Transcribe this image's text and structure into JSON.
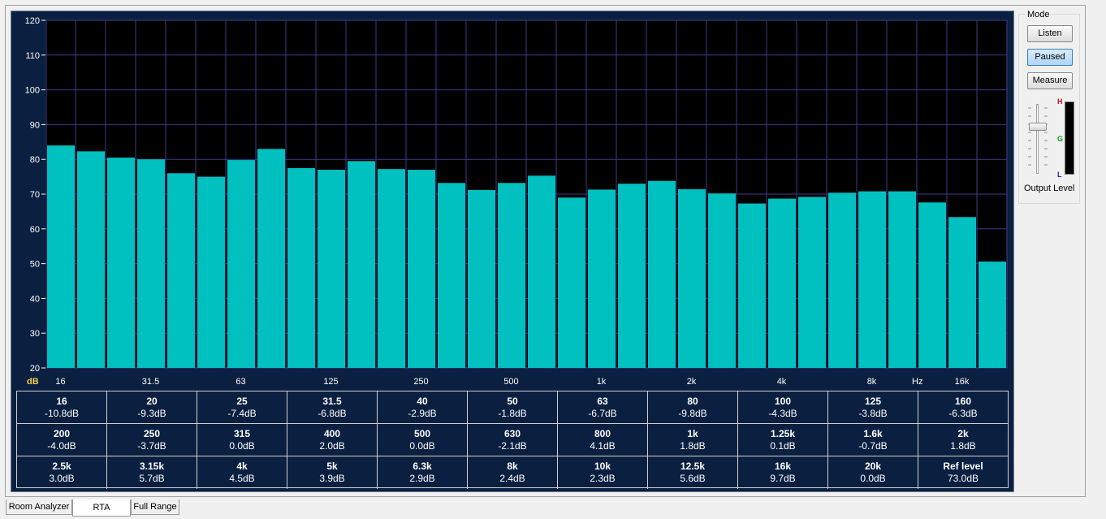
{
  "chart_data": {
    "type": "bar",
    "ylim": [
      20,
      120
    ],
    "yticks": [
      20,
      30,
      40,
      50,
      60,
      70,
      80,
      90,
      100,
      110,
      120
    ],
    "y_unit_label": "dB",
    "x_unit_label": "Hz",
    "x_tick_labels": [
      "16",
      "31.5",
      "63",
      "125",
      "250",
      "500",
      "1k",
      "2k",
      "4k",
      "8k",
      "16k"
    ],
    "grid": true,
    "bar_color": "#00c0c0",
    "values": [
      84,
      82.3,
      80.5,
      80,
      76,
      75,
      79.8,
      83,
      77.5,
      77,
      79.5,
      77.2,
      77,
      73.2,
      71.2,
      73.2,
      75.3,
      69,
      71.3,
      73,
      73.8,
      71.4,
      70.2,
      67.3,
      68.7,
      69.2,
      70.4,
      70.8,
      70.8,
      67.6,
      63.4,
      50.6
    ]
  },
  "eq_table": [
    [
      {
        "f": "16",
        "g": "-10.8dB"
      },
      {
        "f": "20",
        "g": "-9.3dB"
      },
      {
        "f": "25",
        "g": "-7.4dB"
      },
      {
        "f": "31.5",
        "g": "-6.8dB"
      },
      {
        "f": "40",
        "g": "-2.9dB"
      },
      {
        "f": "50",
        "g": "-1.8dB"
      },
      {
        "f": "63",
        "g": "-6.7dB"
      },
      {
        "f": "80",
        "g": "-9.8dB"
      },
      {
        "f": "100",
        "g": "-4.3dB"
      },
      {
        "f": "125",
        "g": "-3.8dB"
      },
      {
        "f": "160",
        "g": "-6.3dB"
      }
    ],
    [
      {
        "f": "200",
        "g": "-4.0dB"
      },
      {
        "f": "250",
        "g": "-3.7dB"
      },
      {
        "f": "315",
        "g": "0.0dB"
      },
      {
        "f": "400",
        "g": "2.0dB"
      },
      {
        "f": "500",
        "g": "0.0dB"
      },
      {
        "f": "630",
        "g": "-2.1dB"
      },
      {
        "f": "800",
        "g": "4.1dB"
      },
      {
        "f": "1k",
        "g": "1.8dB"
      },
      {
        "f": "1.25k",
        "g": "0.1dB"
      },
      {
        "f": "1.6k",
        "g": "-0.7dB"
      },
      {
        "f": "2k",
        "g": "1.8dB"
      }
    ],
    [
      {
        "f": "2.5k",
        "g": "3.0dB"
      },
      {
        "f": "3.15k",
        "g": "5.7dB"
      },
      {
        "f": "4k",
        "g": "4.5dB"
      },
      {
        "f": "5k",
        "g": "3.9dB"
      },
      {
        "f": "6.3k",
        "g": "2.9dB"
      },
      {
        "f": "8k",
        "g": "2.4dB"
      },
      {
        "f": "10k",
        "g": "2.3dB"
      },
      {
        "f": "12.5k",
        "g": "5.6dB"
      },
      {
        "f": "16k",
        "g": "9.7dB"
      },
      {
        "f": "20k",
        "g": "0.0dB"
      },
      {
        "f": "Ref level",
        "g": "73.0dB"
      }
    ]
  ],
  "mode": {
    "title": "Mode",
    "buttons": [
      {
        "label": "Listen",
        "active": false
      },
      {
        "label": "Paused",
        "active": true
      },
      {
        "label": "Measure",
        "active": false
      }
    ],
    "output_level_label": "Output Level",
    "meter_labels": {
      "high": "H",
      "good": "G",
      "low": "L"
    },
    "output_level": 0.7
  },
  "tabs": [
    {
      "label": "Room Analyzer",
      "selected": false
    },
    {
      "label": "RTA",
      "selected": true
    },
    {
      "label": "Full Range",
      "selected": false
    }
  ]
}
